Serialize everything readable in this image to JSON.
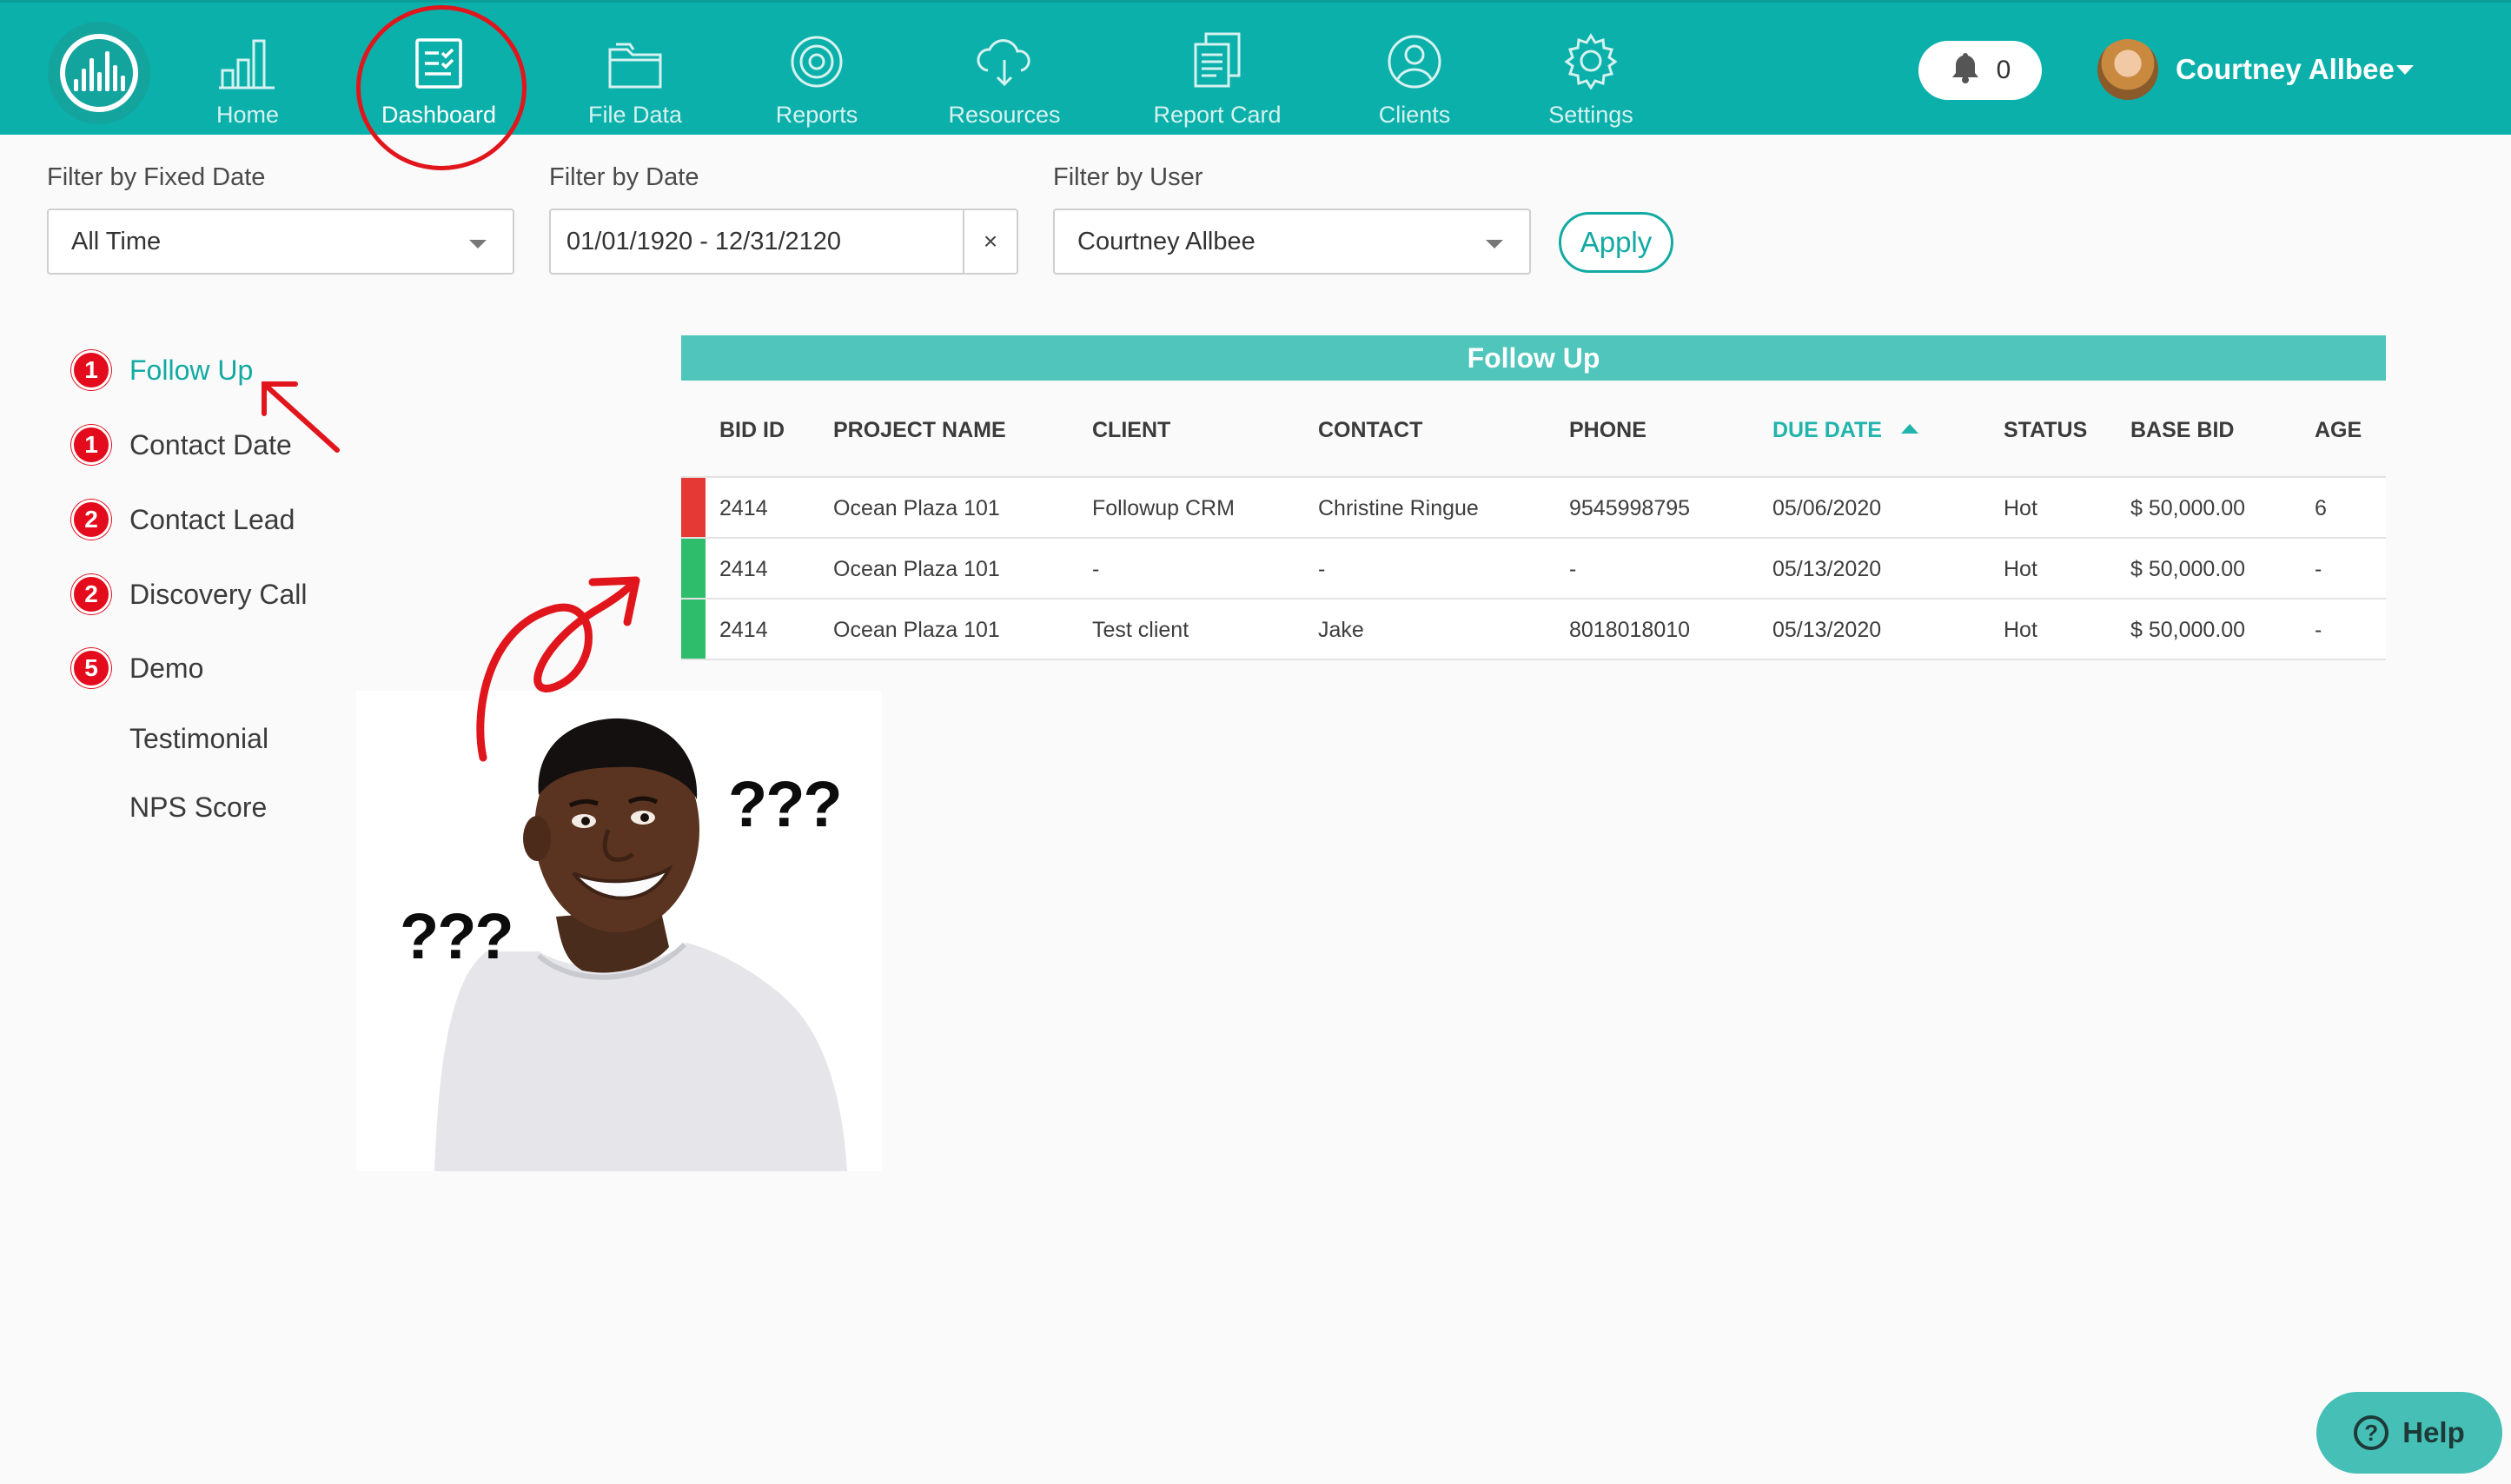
{
  "nav": {
    "items": [
      {
        "label": "Home",
        "icon": "bar-chart-icon"
      },
      {
        "label": "Dashboard",
        "icon": "clipboard-check-icon"
      },
      {
        "label": "File Data",
        "icon": "folder-icon"
      },
      {
        "label": "Reports",
        "icon": "target-icon"
      },
      {
        "label": "Resources",
        "icon": "cloud-download-icon"
      },
      {
        "label": "Report Card",
        "icon": "documents-icon"
      },
      {
        "label": "Clients",
        "icon": "user-circle-icon"
      },
      {
        "label": "Settings",
        "icon": "gear-icon"
      }
    ],
    "active": "Dashboard",
    "notifications_count": "0",
    "user_name": "Courtney Allbee"
  },
  "filters": {
    "fixed_date_label": "Filter by Fixed Date",
    "fixed_date_value": "All Time",
    "date_label": "Filter by Date",
    "date_value": "01/01/1920 - 12/31/2120",
    "clear_symbol": "×",
    "user_label": "Filter by User",
    "user_value": "Courtney Allbee",
    "apply_label": "Apply"
  },
  "stages": [
    {
      "label": "Follow Up",
      "count": "1",
      "active": true
    },
    {
      "label": "Contact Date",
      "count": "1"
    },
    {
      "label": "Contact Lead",
      "count": "2"
    },
    {
      "label": "Discovery Call",
      "count": "2"
    },
    {
      "label": "Demo",
      "count": "5"
    },
    {
      "label": "Testimonial",
      "count": ""
    },
    {
      "label": "NPS Score",
      "count": ""
    }
  ],
  "table": {
    "title": "Follow Up",
    "columns": [
      "BID ID",
      "PROJECT NAME",
      "CLIENT",
      "CONTACT",
      "PHONE",
      "DUE DATE",
      "STATUS",
      "BASE BID",
      "AGE"
    ],
    "sorted_column": "DUE DATE",
    "rows": [
      {
        "status_color": "#e53935",
        "cells": [
          "2414",
          "Ocean Plaza 101",
          "Followup CRM",
          "Christine Ringue",
          "9545998795",
          "05/06/2020",
          "Hot",
          "$ 50,000.00",
          "6"
        ]
      },
      {
        "status_color": "#2ebd6b",
        "cells": [
          "2414",
          "Ocean Plaza 101",
          "-",
          "-",
          "-",
          "05/13/2020",
          "Hot",
          "$ 50,000.00",
          "-"
        ]
      },
      {
        "status_color": "#2ebd6b",
        "cells": [
          "2414",
          "Ocean Plaza 101",
          "Test client",
          "Jake",
          "8018018010",
          "05/13/2020",
          "Hot",
          "$ 50,000.00",
          "-"
        ]
      }
    ]
  },
  "meme": {
    "question_marks_left": "???",
    "question_marks_right": "???"
  },
  "colors": {
    "brand": "#0bb0aa",
    "accent": "#12aaa3",
    "badge": "#e40c1c",
    "annotation": "#e1161c"
  },
  "help": {
    "label": "Help",
    "icon": "question-circle-icon"
  }
}
